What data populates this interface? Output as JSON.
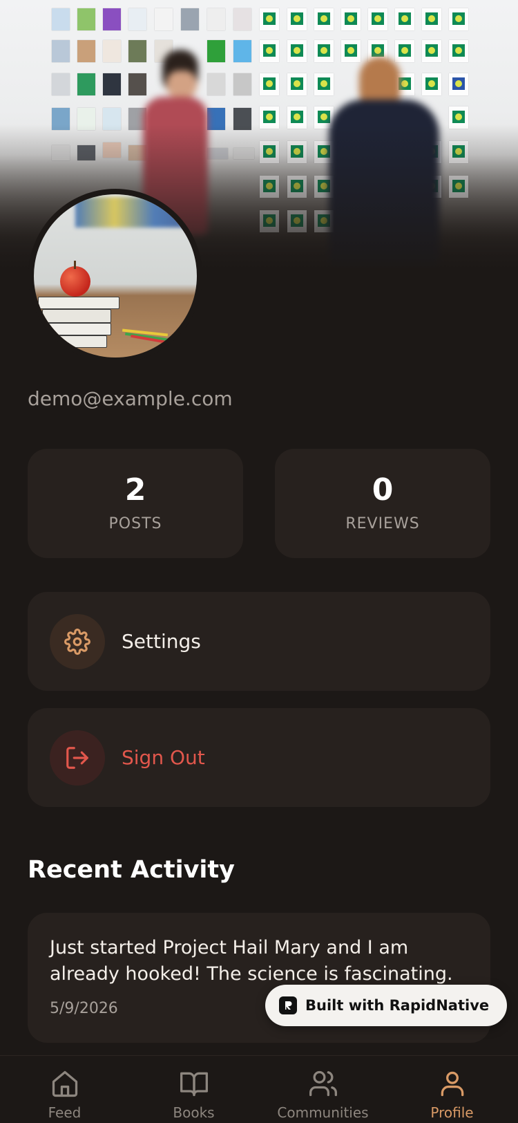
{
  "profile": {
    "email": "demo@example.com"
  },
  "stats": [
    {
      "value": "2",
      "label": "POSTS"
    },
    {
      "value": "0",
      "label": "REVIEWS"
    }
  ],
  "menu": {
    "settings_label": "Settings",
    "signout_label": "Sign Out"
  },
  "recent_activity": {
    "title": "Recent Activity",
    "posts": [
      {
        "text": "Just started Project Hail Mary and I am already hooked! The science is fascinating.",
        "date": "5/9/2026"
      }
    ]
  },
  "badge": {
    "text": "Built with RapidNative"
  },
  "tabs": [
    {
      "label": "Feed",
      "icon": "home-icon"
    },
    {
      "label": "Books",
      "icon": "book-icon"
    },
    {
      "label": "Communities",
      "icon": "users-icon"
    },
    {
      "label": "Profile",
      "icon": "user-icon",
      "active": true
    }
  ],
  "colors": {
    "background": "#1c1816",
    "card": "#27211e",
    "accent": "#d99a66",
    "danger": "#e2574c",
    "muted": "#a8a19b"
  }
}
